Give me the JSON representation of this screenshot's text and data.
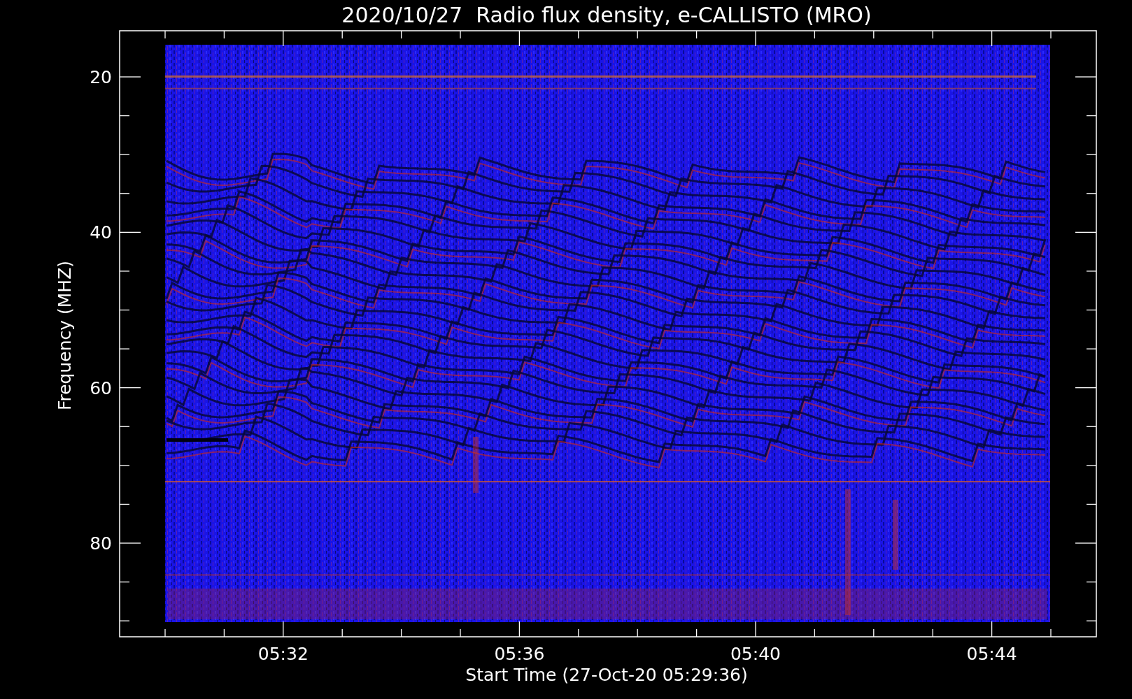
{
  "title": "2020/10/27  Radio flux density, e-CALLISTO (MRO)",
  "y_axis": {
    "label": "Frequency (MHZ)",
    "ticks": [
      "20",
      "40",
      "60",
      "80"
    ]
  },
  "x_axis": {
    "label": "Start Time (27-Oct-20 05:29:36)",
    "ticks": [
      "05:32",
      "05:36",
      "05:40",
      "05:44"
    ]
  }
}
